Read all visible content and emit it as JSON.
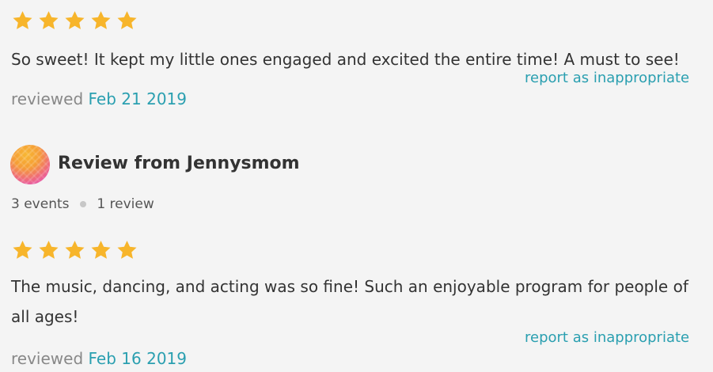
{
  "colors": {
    "background": "#f4f4f4",
    "star": "#f7b52b",
    "link": "#2a9fb0",
    "text": "#333333",
    "muted": "#888888"
  },
  "reviews": [
    {
      "rating": 5,
      "text": "So sweet! It kept my little ones engaged and excited the entire time! A must to see!",
      "report_label": "report as inappropriate",
      "reviewed_prefix": "reviewed",
      "reviewed_date": "Feb 21 2019"
    },
    {
      "reviewer": {
        "avatar_icon": "avatar-icon",
        "name": "Review from Jennysmom",
        "events": "3 events",
        "reviews_count": "1 review"
      },
      "rating": 5,
      "text_line1": "The music, dancing, and acting was so fine! Such an enjoyable program for people of",
      "text_line2": "all ages!",
      "report_label": "report as inappropriate",
      "reviewed_prefix": "reviewed",
      "reviewed_date": "Feb 16 2019"
    }
  ]
}
